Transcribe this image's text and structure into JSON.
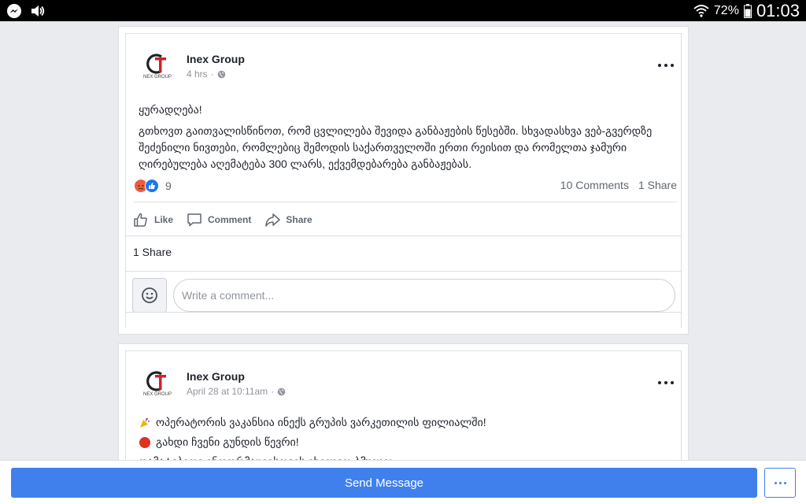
{
  "status_bar": {
    "battery": "72%",
    "time": "01:03",
    "icons": [
      "messenger-icon",
      "volume-icon",
      "wifi-icon",
      "battery-icon"
    ]
  },
  "posts": [
    {
      "author": "Inex Group",
      "time": "4 hrs",
      "meta_sep": "·",
      "text": [
        "ყურადღება!",
        "გთხოვთ გაითვალისწინოთ, რომ ცვლილება შევიდა განბაჟების წესებში. სხვადასხვა ვებ-გვერდზე შეძენილი ნივთები, რომლებიც შემოდის საქართველოში ერთი რეისით და რომელთა ჯამური ღირებულება აღემატება 300 ლარს, ექვემდებარება განბაჟებას."
      ],
      "reaction_count": "9",
      "comments": "10 Comments",
      "shares": "1 Share",
      "actions": {
        "like": "Like",
        "comment": "Comment",
        "share": "Share"
      },
      "shares_row": "1 Share",
      "comment_placeholder": "Write a comment..."
    },
    {
      "author": "Inex Group",
      "time": "April 28 at 10:11am",
      "meta_sep": "·",
      "lines": [
        {
          "icon": "party-popper-icon",
          "text": "ოპერატორის ვაკანსია ინექს გრუპის ვარკეთილის ფილიალში!"
        },
        {
          "icon": "red-circle-icon",
          "text": "გახდი ჩვენი გუნდის წევრი!"
        },
        {
          "icon": "",
          "text": "დამატებითი ინფორმაციისთვის იხილეთ ბმული:"
        }
      ]
    }
  ],
  "bottom_bar": {
    "send_label": "Send Message"
  },
  "colors": {
    "accent": "#4080ec",
    "background": "#e9ebee",
    "text_secondary": "#606770",
    "angry": "#f05b3f",
    "like": "#1877f2"
  }
}
